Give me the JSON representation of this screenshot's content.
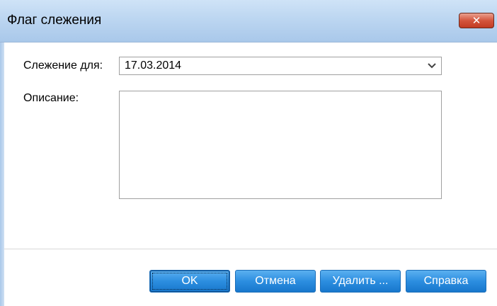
{
  "window": {
    "title": "Флаг слежения",
    "close_icon": "close-icon"
  },
  "form": {
    "follow_up_label": "Слежение для:",
    "follow_up_value": "17.03.2014",
    "description_label": "Описание:",
    "description_value": ""
  },
  "buttons": {
    "ok": "OK",
    "cancel": "Отмена",
    "delete": "Удалить ...",
    "help": "Справка"
  },
  "colors": {
    "titlebar": "#bcd6f1",
    "button": "#2c8ee0",
    "close": "#d4553d"
  }
}
